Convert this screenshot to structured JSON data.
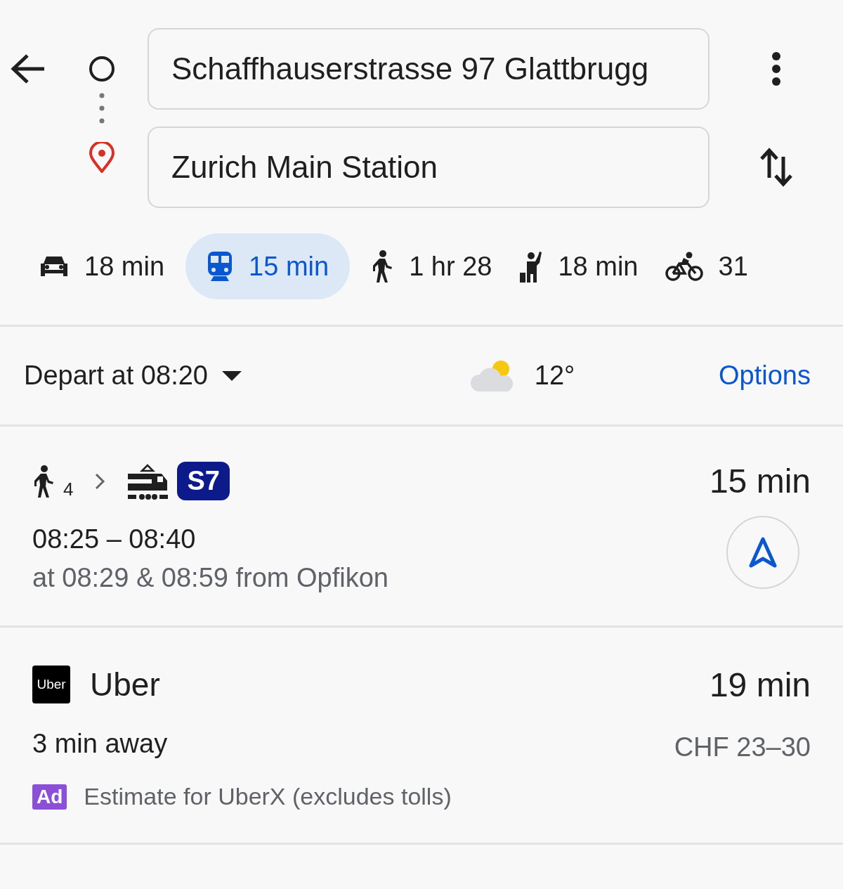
{
  "origin": {
    "value": "Schaffhauserstrasse 97 Glattbrugg"
  },
  "destination": {
    "value": "Zurich Main Station"
  },
  "modes": [
    {
      "kind": "car",
      "label": "18 min",
      "selected": false
    },
    {
      "kind": "transit",
      "label": "15 min",
      "selected": true
    },
    {
      "kind": "walk",
      "label": "1 hr 28",
      "selected": false
    },
    {
      "kind": "ride",
      "label": "18 min",
      "selected": false
    },
    {
      "kind": "bike",
      "label": "31",
      "selected": false
    }
  ],
  "depart": {
    "label": "Depart at 08:20",
    "temperature": "12°",
    "options": "Options"
  },
  "transit_route": {
    "steps": [
      {
        "kind": "walk",
        "label": "4"
      },
      {
        "kind": "train",
        "line": "S7"
      }
    ],
    "duration": "15 min",
    "times": "08:25 – 08:40",
    "departures": "at 08:29 & 08:59 from Opfikon"
  },
  "ride_option": {
    "logo_text": "Uber",
    "name": "Uber",
    "duration": "19 min",
    "eta": "3 min away",
    "price": "CHF 23–30",
    "ad_badge": "Ad",
    "note": "Estimate for UberX (excludes tolls)"
  }
}
